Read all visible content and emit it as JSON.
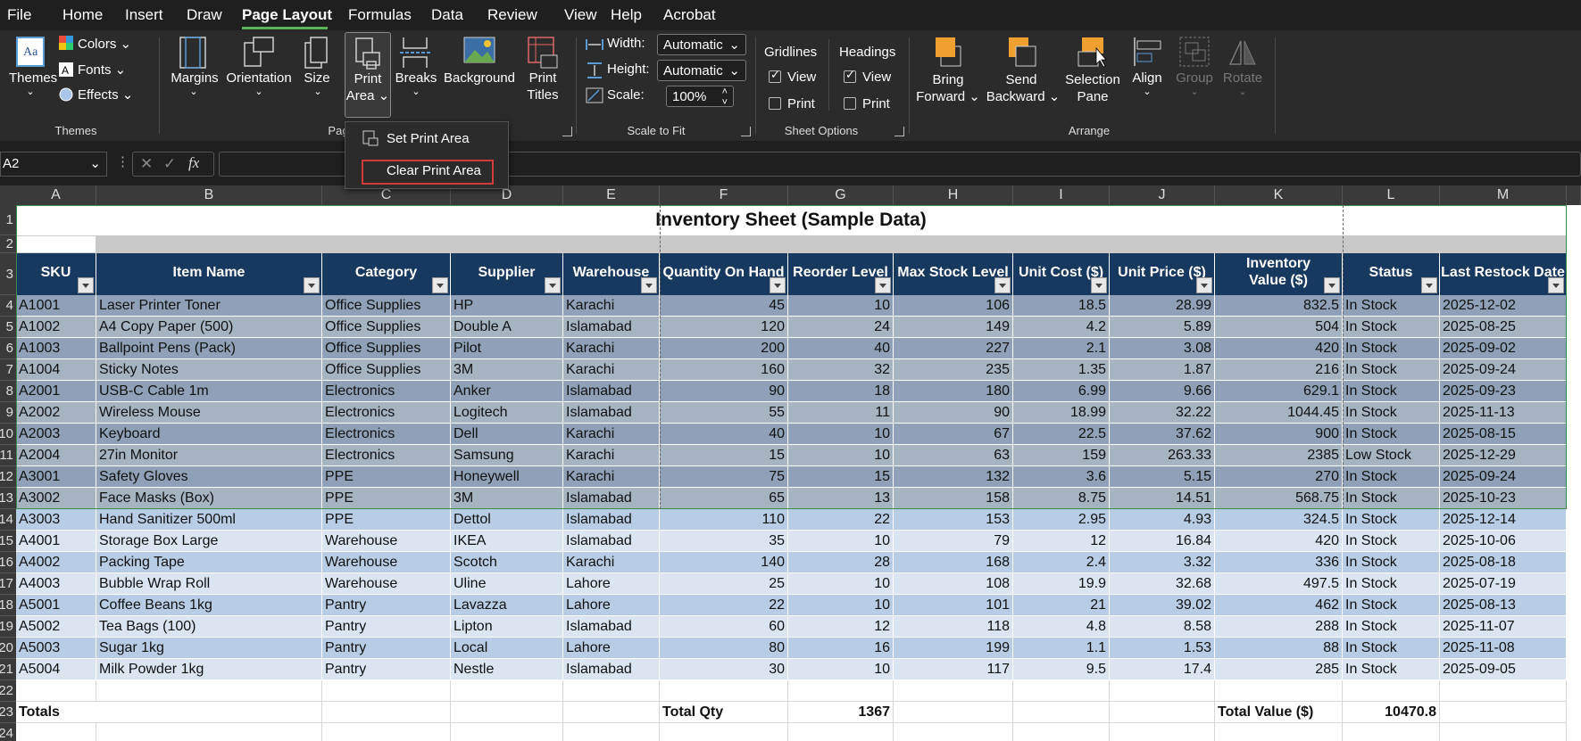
{
  "menu": [
    "File",
    "Home",
    "Insert",
    "Draw",
    "Page Layout",
    "Formulas",
    "Data",
    "Review",
    "View",
    "Help",
    "Acrobat"
  ],
  "ribbon": {
    "themes": {
      "label": "Themes",
      "colors": "Colors",
      "fonts": "Fonts",
      "effects": "Effects",
      "group": "Themes"
    },
    "page_setup": {
      "margins": "Margins",
      "orientation": "Orientation",
      "size": "Size",
      "print_area": [
        "Print",
        "Area"
      ],
      "breaks": "Breaks",
      "background": "Background",
      "print_titles": [
        "Print",
        "Titles"
      ],
      "group": "Pag"
    },
    "scale_to_fit": {
      "width_label": "Width:",
      "width_value": "Automatic",
      "height_label": "Height:",
      "height_value": "Automatic",
      "scale_label": "Scale:",
      "scale_value": "100%",
      "group": "Scale to Fit"
    },
    "sheet_options": {
      "gridlines": "Gridlines",
      "headings": "Headings",
      "view": "View",
      "print": "Print",
      "group": "Sheet Options"
    },
    "arrange": {
      "bring_forward": [
        "Bring",
        "Forward"
      ],
      "send_backward": [
        "Send",
        "Backward"
      ],
      "selection_pane": [
        "Selection",
        "Pane"
      ],
      "align": "Align",
      "group_btn": "Group",
      "rotate": "Rotate",
      "group": "Arrange"
    }
  },
  "popup": {
    "set_print_area": "Set Print Area",
    "clear_print_area": "Clear Print Area"
  },
  "formula_bar": {
    "name_box": "A2",
    "fx": "fx"
  },
  "columns": [
    "A",
    "B",
    "C",
    "D",
    "E",
    "F",
    "G",
    "H",
    "I",
    "J",
    "K",
    "L",
    "M"
  ],
  "rows": [
    "1",
    "2",
    "3",
    "4",
    "5",
    "6",
    "7",
    "8",
    "9",
    "10",
    "11",
    "12",
    "13",
    "14",
    "15",
    "16",
    "17",
    "18",
    "19",
    "20",
    "21",
    "22",
    "23",
    "24"
  ],
  "sheet": {
    "title": "Inventory Sheet (Sample Data)",
    "headers": [
      "SKU",
      "Item Name",
      "Category",
      "Supplier",
      "Warehouse",
      "Quantity On Hand",
      "Reorder Level",
      "Max Stock Level",
      "Unit Cost ($)",
      "Unit Price ($)",
      "Inventory Value ($)",
      "Status",
      "Last Restock Date"
    ],
    "data": [
      [
        "A1001",
        "Laser Printer Toner",
        "Office Supplies",
        "HP",
        "Karachi",
        "45",
        "10",
        "106",
        "18.5",
        "28.99",
        "832.5",
        "In Stock",
        "2025-12-02"
      ],
      [
        "A1002",
        "A4 Copy Paper (500)",
        "Office Supplies",
        "Double A",
        "Islamabad",
        "120",
        "24",
        "149",
        "4.2",
        "5.89",
        "504",
        "In Stock",
        "2025-08-25"
      ],
      [
        "A1003",
        "Ballpoint Pens (Pack)",
        "Office Supplies",
        "Pilot",
        "Karachi",
        "200",
        "40",
        "227",
        "2.1",
        "3.08",
        "420",
        "In Stock",
        "2025-09-02"
      ],
      [
        "A1004",
        "Sticky Notes",
        "Office Supplies",
        "3M",
        "Karachi",
        "160",
        "32",
        "235",
        "1.35",
        "1.87",
        "216",
        "In Stock",
        "2025-09-24"
      ],
      [
        "A2001",
        "USB-C Cable 1m",
        "Electronics",
        "Anker",
        "Islamabad",
        "90",
        "18",
        "180",
        "6.99",
        "9.66",
        "629.1",
        "In Stock",
        "2025-09-23"
      ],
      [
        "A2002",
        "Wireless Mouse",
        "Electronics",
        "Logitech",
        "Islamabad",
        "55",
        "11",
        "90",
        "18.99",
        "32.22",
        "1044.45",
        "In Stock",
        "2025-11-13"
      ],
      [
        "A2003",
        "Keyboard",
        "Electronics",
        "Dell",
        "Karachi",
        "40",
        "10",
        "67",
        "22.5",
        "37.62",
        "900",
        "In Stock",
        "2025-08-15"
      ],
      [
        "A2004",
        "27in Monitor",
        "Electronics",
        "Samsung",
        "Karachi",
        "15",
        "10",
        "63",
        "159",
        "263.33",
        "2385",
        "Low Stock",
        "2025-12-29"
      ],
      [
        "A3001",
        "Safety Gloves",
        "PPE",
        "Honeywell",
        "Karachi",
        "75",
        "15",
        "132",
        "3.6",
        "5.15",
        "270",
        "In Stock",
        "2025-09-24"
      ],
      [
        "A3002",
        "Face Masks (Box)",
        "PPE",
        "3M",
        "Islamabad",
        "65",
        "13",
        "158",
        "8.75",
        "14.51",
        "568.75",
        "In Stock",
        "2025-10-23"
      ],
      [
        "A3003",
        "Hand Sanitizer 500ml",
        "PPE",
        "Dettol",
        "Islamabad",
        "110",
        "22",
        "153",
        "2.95",
        "4.93",
        "324.5",
        "In Stock",
        "2025-12-14"
      ],
      [
        "A4001",
        "Storage Box Large",
        "Warehouse",
        "IKEA",
        "Islamabad",
        "35",
        "10",
        "79",
        "12",
        "16.84",
        "420",
        "In Stock",
        "2025-10-06"
      ],
      [
        "A4002",
        "Packing Tape",
        "Warehouse",
        "Scotch",
        "Karachi",
        "140",
        "28",
        "168",
        "2.4",
        "3.32",
        "336",
        "In Stock",
        "2025-08-18"
      ],
      [
        "A4003",
        "Bubble Wrap Roll",
        "Warehouse",
        "Uline",
        "Lahore",
        "25",
        "10",
        "108",
        "19.9",
        "32.68",
        "497.5",
        "In Stock",
        "2025-07-19"
      ],
      [
        "A5001",
        "Coffee Beans 1kg",
        "Pantry",
        "Lavazza",
        "Lahore",
        "22",
        "10",
        "101",
        "21",
        "39.02",
        "462",
        "In Stock",
        "2025-08-13"
      ],
      [
        "A5002",
        "Tea Bags (100)",
        "Pantry",
        "Lipton",
        "Islamabad",
        "60",
        "12",
        "118",
        "4.8",
        "8.58",
        "288",
        "In Stock",
        "2025-11-07"
      ],
      [
        "A5003",
        "Sugar 1kg",
        "Pantry",
        "Local",
        "Lahore",
        "80",
        "16",
        "199",
        "1.1",
        "1.53",
        "88",
        "In Stock",
        "2025-11-08"
      ],
      [
        "A5004",
        "Milk Powder 1kg",
        "Pantry",
        "Nestle",
        "Islamabad",
        "30",
        "10",
        "117",
        "9.5",
        "17.4",
        "285",
        "In Stock",
        "2025-09-05"
      ]
    ],
    "totals": {
      "label": "Totals",
      "qty_label": "Total Qty",
      "qty": "1367",
      "value_label": "Total Value ($)",
      "value": "10470.8"
    }
  },
  "colors": {
    "header_bg": "#17385f",
    "band_dark": "#8ea1b8",
    "band_light": "#a6b3c1",
    "lower_dark": "#b7cde6",
    "lower_light": "#dae5f1",
    "accent": "#5ab55a",
    "highlight": "#d23b3b"
  }
}
